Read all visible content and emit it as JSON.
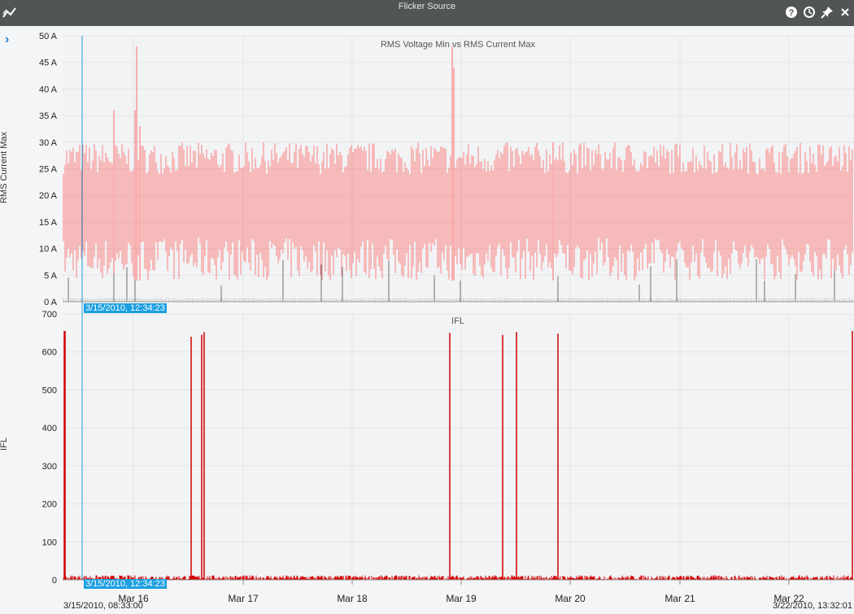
{
  "window": {
    "title": "Flicker Source",
    "icons": [
      "chart-line-icon",
      "help-icon",
      "history-icon",
      "pin-icon",
      "close-icon"
    ]
  },
  "cursor": {
    "label": "3/15/2010, 12:34:23"
  },
  "x_axis": {
    "tick_labels": [
      "Mar 16",
      "Mar 17",
      "Mar 18",
      "Mar 19",
      "Mar 20",
      "Mar 21",
      "Mar 22"
    ],
    "start_label": "3/15/2010, 08:33:00",
    "end_label": "3/22/2010, 13:32:01"
  },
  "colors": {
    "titlebar": "#515556",
    "series_red": "#ff6b6b",
    "ifl_red": "#d40000",
    "gray_series": "#707070",
    "cursor": "#1a9fe0"
  },
  "chart_data": [
    {
      "type": "line",
      "title": "RMS Voltage Min vs RMS Current Max",
      "ylabel": "RMS Current Max",
      "ylim": [
        0,
        50
      ],
      "y_tick_labels": [
        "0 A",
        "5 A",
        "10 A",
        "15 A",
        "20 A",
        "25 A",
        "30 A",
        "35 A",
        "40 A",
        "45 A",
        "50 A"
      ],
      "series": [
        {
          "values_note": "dense periodic current series, typical peaks 24-30 A, spikes to 48 A near Mar 16 and Mar 19"
        },
        {
          "values_note": "gray series near 3-8 A with occasional spikes"
        }
      ]
    },
    {
      "type": "line",
      "title": "IFL",
      "ylabel": "IFL",
      "ylim": [
        0,
        700
      ],
      "y_tick_labels": [
        "0",
        "100",
        "200",
        "300",
        "400",
        "500",
        "600",
        "700"
      ],
      "series": [
        {
          "values_note": "mostly near 0-15 with spikes to about 640-655"
        }
      ]
    }
  ]
}
